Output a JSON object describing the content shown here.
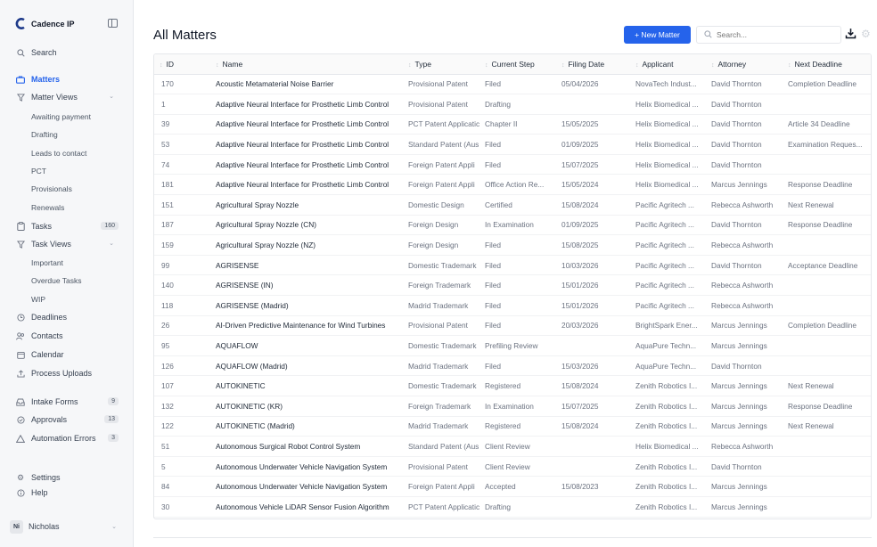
{
  "app": {
    "name": "Cadence IP",
    "brand_color": "#1e3a8a"
  },
  "sidebar": {
    "search": "Search",
    "matters": "Matters",
    "matter_views": "Matter Views",
    "matter_view_items": [
      "Awaiting payment",
      "Drafting",
      "Leads to contact",
      "PCT",
      "Provisionals",
      "Renewals"
    ],
    "tasks": "Tasks",
    "tasks_count": "160",
    "task_views": "Task Views",
    "task_view_items": [
      "Important",
      "Overdue Tasks",
      "WIP"
    ],
    "deadlines": "Deadlines",
    "contacts": "Contacts",
    "calendar": "Calendar",
    "process_uploads": "Process Uploads",
    "intake_forms": "Intake Forms",
    "intake_forms_count": "9",
    "approvals": "Approvals",
    "approvals_count": "13",
    "automation_errors": "Automation Errors",
    "automation_errors_count": "3",
    "settings": "Settings",
    "help": "Help"
  },
  "user": {
    "initials": "Ni",
    "name": "Nicholas"
  },
  "header": {
    "title": "All Matters",
    "new_button": "+ New Matter",
    "search_placeholder": "Search..."
  },
  "table": {
    "columns": [
      "ID",
      "Name",
      "Type",
      "Current Step",
      "Filing Date",
      "Applicant",
      "Attorney",
      "Next Deadline"
    ],
    "rows": [
      [
        "170",
        "Acoustic Metamaterial Noise Barrier",
        "Provisional Patent",
        "Filed",
        "05/04/2026",
        "NovaTech Indust...",
        "David Thornton",
        "Completion Deadline"
      ],
      [
        "1",
        "Adaptive Neural Interface for Prosthetic Limb Control",
        "Provisional Patent",
        "Drafting",
        "",
        "Helix Biomedical ...",
        "David Thornton",
        ""
      ],
      [
        "39",
        "Adaptive Neural Interface for Prosthetic Limb Control",
        "PCT Patent Applicatic",
        "Chapter II",
        "15/05/2025",
        "Helix Biomedical ...",
        "David Thornton",
        "Article 34 Deadline"
      ],
      [
        "53",
        "Adaptive Neural Interface for Prosthetic Limb Control",
        "Standard Patent (Aus",
        "Filed",
        "01/09/2025",
        "Helix Biomedical ...",
        "David Thornton",
        "Examination Reques..."
      ],
      [
        "74",
        "Adaptive Neural Interface for Prosthetic Limb Control",
        "Foreign Patent Appli",
        "Filed",
        "15/07/2025",
        "Helix Biomedical ...",
        "David Thornton",
        ""
      ],
      [
        "181",
        "Adaptive Neural Interface for Prosthetic Limb Control",
        "Foreign Patent Appli",
        "Office Action Re...",
        "15/05/2024",
        "Helix Biomedical ...",
        "Marcus Jennings",
        "Response Deadline"
      ],
      [
        "151",
        "Agricultural Spray Nozzle",
        "Domestic Design",
        "Certified",
        "15/08/2024",
        "Pacific Agritech ...",
        "Rebecca Ashworth",
        "Next Renewal"
      ],
      [
        "187",
        "Agricultural Spray Nozzle (CN)",
        "Foreign Design",
        "In Examination",
        "01/09/2025",
        "Pacific Agritech ...",
        "David Thornton",
        "Response Deadline"
      ],
      [
        "159",
        "Agricultural Spray Nozzle (NZ)",
        "Foreign Design",
        "Filed",
        "15/08/2025",
        "Pacific Agritech ...",
        "Rebecca Ashworth",
        ""
      ],
      [
        "99",
        "AGRISENSE",
        "Domestic Trademark",
        "Filed",
        "10/03/2026",
        "Pacific Agritech ...",
        "David Thornton",
        "Acceptance Deadline"
      ],
      [
        "140",
        "AGRISENSE (IN)",
        "Foreign Trademark",
        "Filed",
        "15/01/2026",
        "Pacific Agritech ...",
        "Rebecca Ashworth",
        ""
      ],
      [
        "118",
        "AGRISENSE (Madrid)",
        "Madrid Trademark",
        "Filed",
        "15/01/2026",
        "Pacific Agritech ...",
        "Rebecca Ashworth",
        ""
      ],
      [
        "26",
        "AI-Driven Predictive Maintenance for Wind Turbines",
        "Provisional Patent",
        "Filed",
        "20/03/2026",
        "BrightSpark Ener...",
        "Marcus Jennings",
        "Completion Deadline"
      ],
      [
        "95",
        "AQUAFLOW",
        "Domestic Trademark",
        "Prefiling Review",
        "",
        "AquaPure Techn...",
        "Marcus Jennings",
        ""
      ],
      [
        "126",
        "AQUAFLOW (Madrid)",
        "Madrid Trademark",
        "Filed",
        "15/03/2026",
        "AquaPure Techn...",
        "David Thornton",
        ""
      ],
      [
        "107",
        "AUTOKINETIC",
        "Domestic Trademark",
        "Registered",
        "15/08/2024",
        "Zenith Robotics I...",
        "Marcus Jennings",
        "Next Renewal"
      ],
      [
        "132",
        "AUTOKINETIC (KR)",
        "Foreign Trademark",
        "In Examination",
        "15/07/2025",
        "Zenith Robotics I...",
        "Marcus Jennings",
        "Response Deadline"
      ],
      [
        "122",
        "AUTOKINETIC (Madrid)",
        "Madrid Trademark",
        "Registered",
        "15/08/2024",
        "Zenith Robotics I...",
        "Marcus Jennings",
        "Next Renewal"
      ],
      [
        "51",
        "Autonomous Surgical Robot Control System",
        "Standard Patent (Aus",
        "Client Review",
        "",
        "Helix Biomedical ...",
        "Rebecca Ashworth",
        ""
      ],
      [
        "5",
        "Autonomous Underwater Vehicle Navigation System",
        "Provisional Patent",
        "Client Review",
        "",
        "Zenith Robotics I...",
        "David Thornton",
        ""
      ],
      [
        "84",
        "Autonomous Underwater Vehicle Navigation System",
        "Foreign Patent Appli",
        "Accepted",
        "15/08/2023",
        "Zenith Robotics I...",
        "Marcus Jennings",
        ""
      ],
      [
        "30",
        "Autonomous Vehicle LiDAR Sensor Fusion Algorithm",
        "PCT Patent Applicatic",
        "Drafting",
        "",
        "Zenith Robotics I...",
        "Marcus Jennings",
        ""
      ]
    ]
  }
}
